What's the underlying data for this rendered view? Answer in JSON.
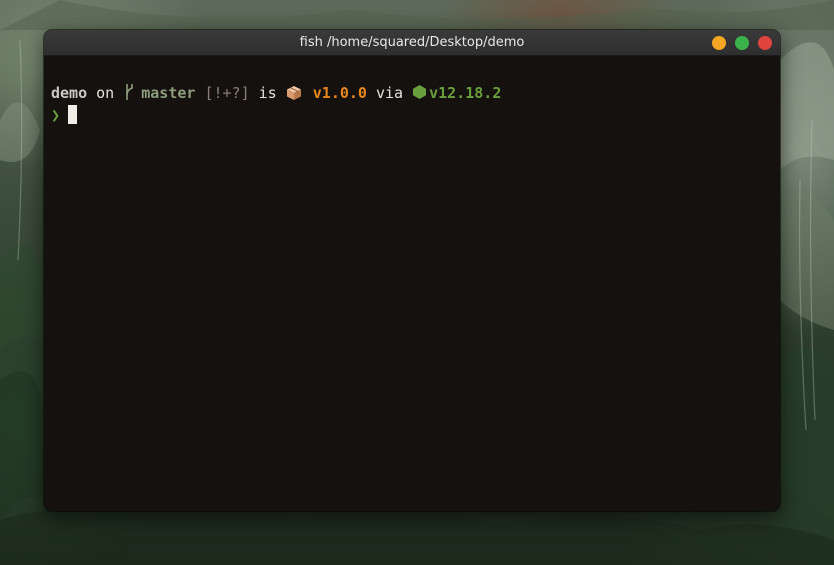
{
  "window": {
    "title": "fish /home/squared/Desktop/demo",
    "controls": [
      {
        "name": "minimize",
        "color": "#f5a623"
      },
      {
        "name": "maximize",
        "color": "#3cb34a"
      },
      {
        "name": "close",
        "color": "#e0443e"
      }
    ]
  },
  "prompt": {
    "directory": "demo",
    "on_text": "on",
    "branch_icon": "git-branch-icon",
    "branch": "master",
    "git_status": "[!+?]",
    "is_text": "is",
    "package_icon": "package-icon",
    "package_version": "v1.0.0",
    "via_text": "via",
    "node_icon": "nodejs-icon",
    "node_version": "v12.18.2",
    "prompt_char": "❯"
  },
  "colors": {
    "directory": "#c9c9c9",
    "branch": "#8d9d7e",
    "git_status": "#8a7f78",
    "package": "#e8871e",
    "node": "#6a9f3d",
    "prompt_char": "#6a9f3d",
    "background": "#15110e"
  }
}
